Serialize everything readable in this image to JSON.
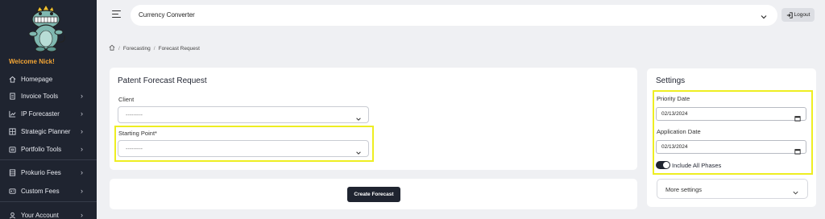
{
  "sidebar": {
    "welcome": "Welcome Nick!",
    "items": [
      {
        "label": "Homepage",
        "icon": "home-icon",
        "chevron": false
      },
      {
        "label": "Invoice Tools",
        "icon": "document-icon",
        "chevron": true
      },
      {
        "label": "IP Forecaster",
        "icon": "line-chart-icon",
        "chevron": true
      },
      {
        "label": "Strategic Planner",
        "icon": "grid-icon",
        "chevron": true
      },
      {
        "label": "Portfolio Tools",
        "icon": "briefcase-icon",
        "chevron": true
      },
      {
        "label": "Prokurio Fees",
        "icon": "building-icon",
        "chevron": true
      },
      {
        "label": "Custom Fees",
        "icon": "id-card-icon",
        "chevron": true
      },
      {
        "label": "Your Account",
        "icon": "user-icon",
        "chevron": true
      }
    ]
  },
  "topbar": {
    "search_value": "Currency Converter",
    "logout_label": "Logout"
  },
  "breadcrumb": {
    "items": [
      "Forecasting",
      "Forecast Request"
    ]
  },
  "forecast": {
    "title": "Patent Forecast Request",
    "client_label": "Client",
    "client_value": "---------",
    "starting_label": "Starting Point*",
    "starting_value": "---------",
    "create_label": "Create Forecast"
  },
  "settings": {
    "title": "Settings",
    "priority_label": "Priority Date",
    "priority_value": "02/13/2024",
    "application_label": "Application Date",
    "application_value": "02/13/2024",
    "toggle_label": "Include All Phases",
    "more_label": "More settings"
  },
  "colors": {
    "sidebar_bg": "#1f2430",
    "accent": "#f3a535",
    "highlight": "#eeee22"
  }
}
